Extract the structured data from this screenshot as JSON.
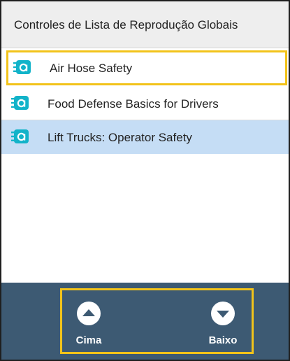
{
  "header": {
    "title": "Controles de Lista de Reprodução Globais"
  },
  "playlist": {
    "items": [
      {
        "label": "Air Hose Safety",
        "icon": "course-icon"
      },
      {
        "label": "Food Defense Basics for Drivers",
        "icon": "course-icon"
      },
      {
        "label": "Lift Trucks: Operator Safety",
        "icon": "course-icon"
      }
    ],
    "selected_index": 2,
    "focused_index": 0
  },
  "footer": {
    "up_label": "Cima",
    "down_label": "Baixo"
  },
  "colors": {
    "accent_teal": "#12b3c9",
    "focus_yellow": "#f2c31a",
    "footer_bg": "#3d5a73",
    "selected_bg": "#c5ddf5",
    "header_bg": "#eeeeee"
  }
}
